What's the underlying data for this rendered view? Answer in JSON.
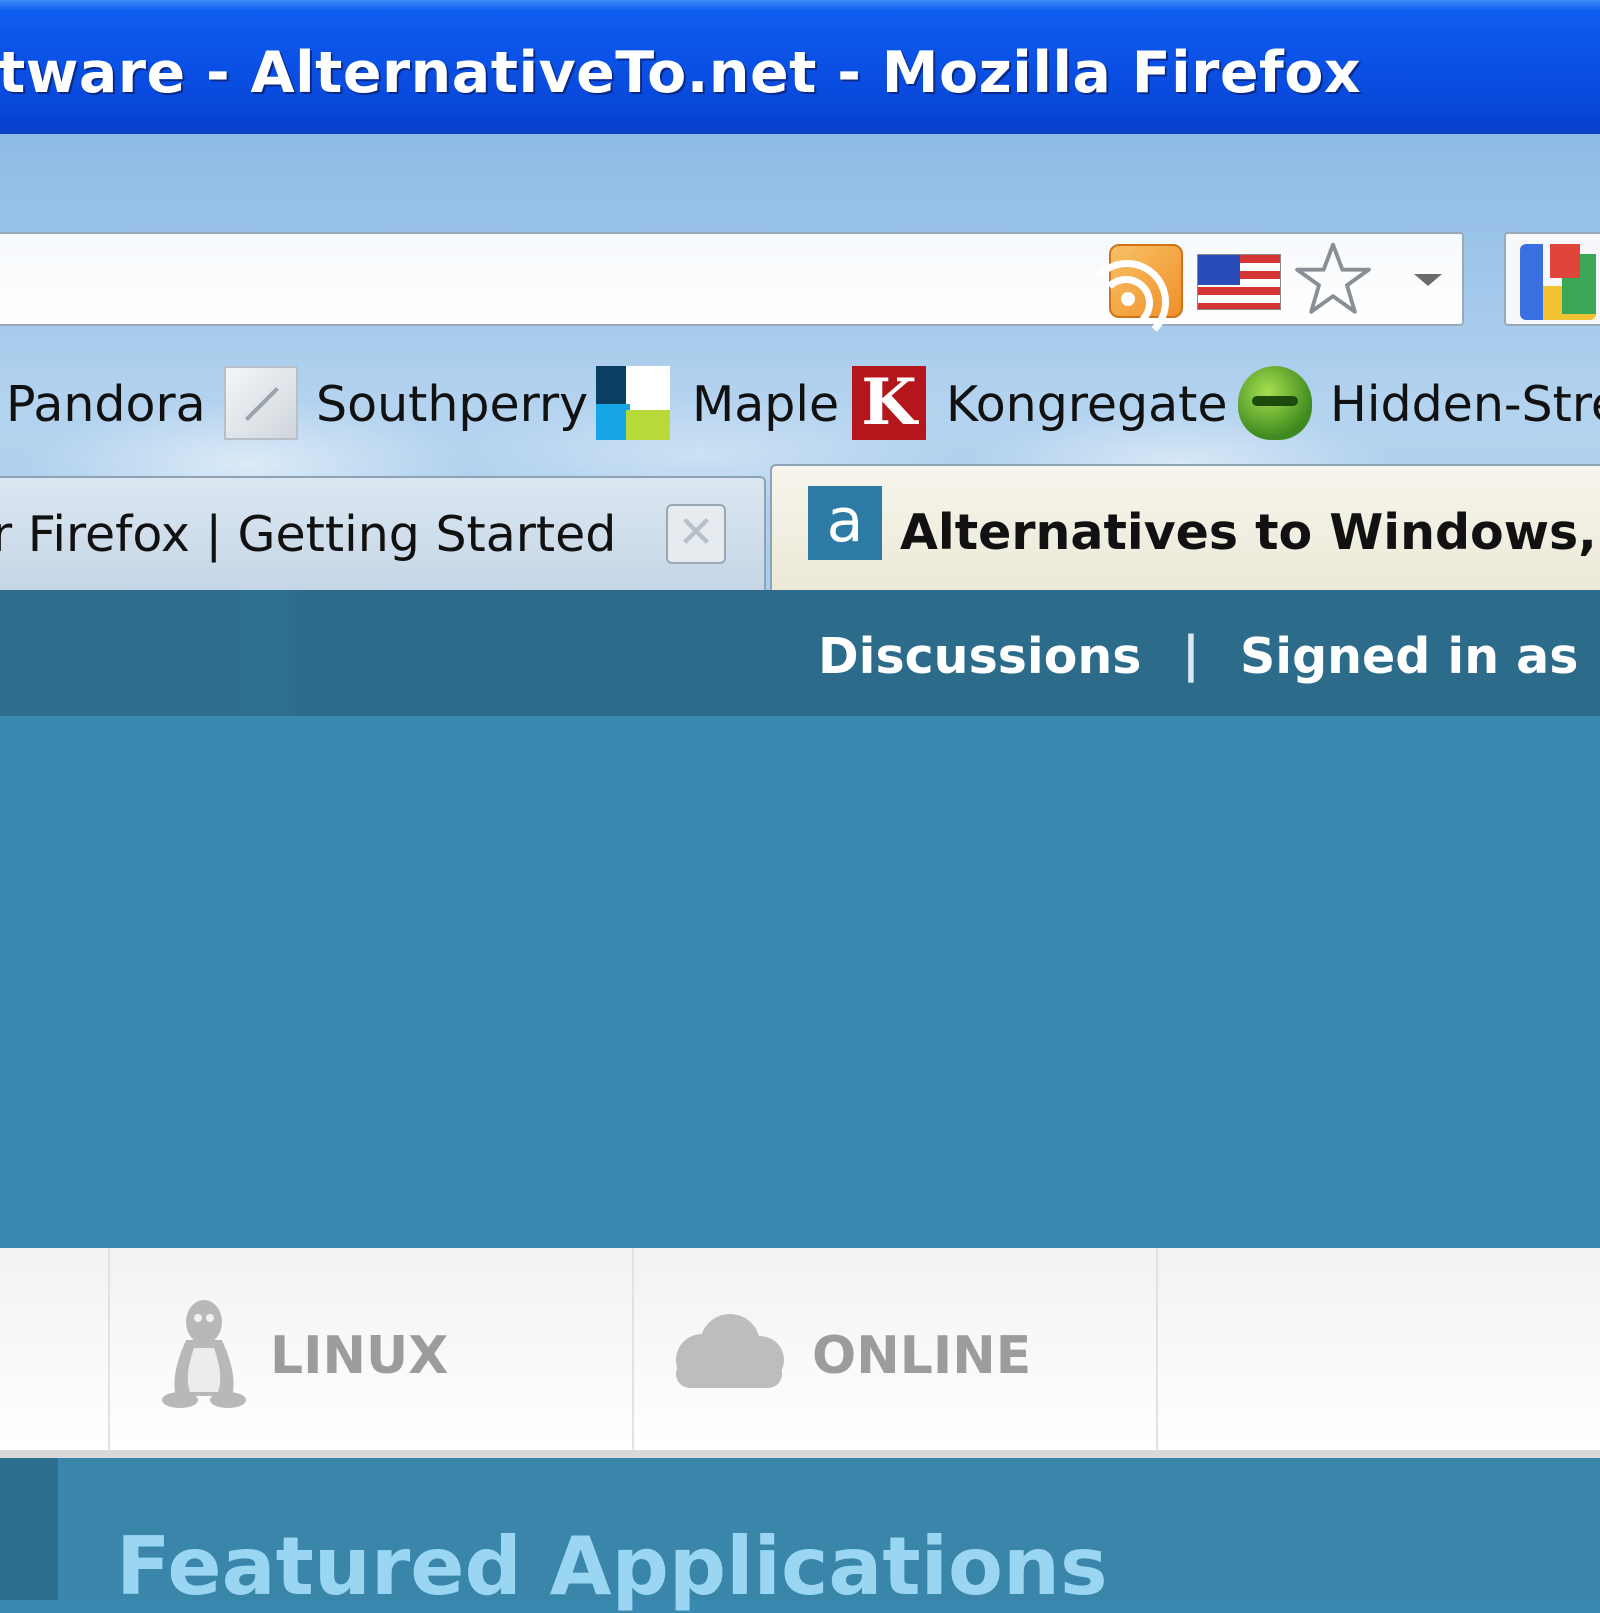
{
  "window": {
    "title": "tware - AlternativeTo.net - Mozilla Firefox"
  },
  "toolbar": {
    "icons": [
      "rss-icon",
      "us-flag-icon",
      "bookmark-star-icon",
      "dropdown-arrow-icon",
      "google-search-icon"
    ]
  },
  "bookmarks": [
    {
      "label": "Pandora",
      "icon": "none"
    },
    {
      "label": "Southperry",
      "icon": "southperry-icon"
    },
    {
      "label": "Maple",
      "icon": "maple-icon"
    },
    {
      "label": "Kongregate",
      "icon": "kongregate-icon"
    },
    {
      "label": "Hidden-Stre",
      "icon": "hidden-street-icon"
    }
  ],
  "tabs": [
    {
      "label": "r Firefox | Getting Started",
      "active": false
    },
    {
      "label": "Alternatives to Windows, M",
      "active": true,
      "icon_letter": "a"
    }
  ],
  "site": {
    "nav": {
      "discussions": "Discussions",
      "separator": "|",
      "signed_in": "Signed in as"
    },
    "platforms": [
      {
        "label": "LINUX",
        "icon": "tux-penguin-icon"
      },
      {
        "label": "ONLINE",
        "icon": "cloud-icon"
      }
    ],
    "featured_title": "Featured Applications"
  },
  "colors": {
    "titlebar": "#0a50e4",
    "nav_bar": "#2c6b89",
    "content_bg": "#3a89b0",
    "featured_title": "#9ad6f2"
  }
}
